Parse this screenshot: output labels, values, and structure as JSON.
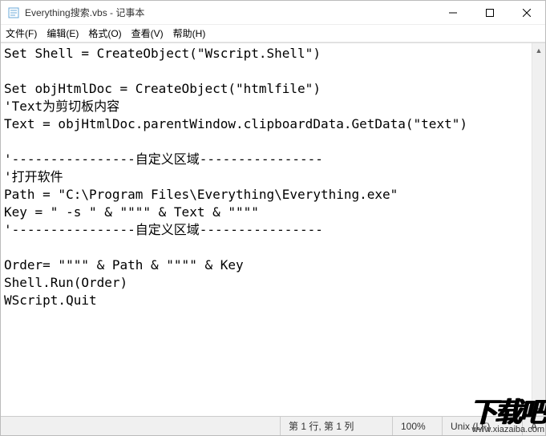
{
  "window": {
    "title": "Everything搜索.vbs - 记事本"
  },
  "menu": {
    "file": "文件(F)",
    "edit": "编辑(E)",
    "format": "格式(O)",
    "view": "查看(V)",
    "help": "帮助(H)"
  },
  "code": {
    "l1": "Set Shell = CreateObject(\"Wscript.Shell\")",
    "l2": "",
    "l3": "Set objHtmlDoc = CreateObject(\"htmlfile\")",
    "l4": "'Text为剪切板内容",
    "l5": "Text = objHtmlDoc.parentWindow.clipboardData.GetData(\"text\")",
    "l6": "",
    "l7": "'----------------自定义区域----------------",
    "l8": "'打开软件",
    "l9": "Path = \"C:\\Program Files\\Everything\\Everything.exe\"",
    "l10": "Key = \" -s \" & \"\"\"\" & Text & \"\"\"\"",
    "l11": "'----------------自定义区域----------------",
    "l12": "",
    "l13": "Order= \"\"\"\" & Path & \"\"\"\" & Key",
    "l14": "Shell.Run(Order)",
    "l15": "WScript.Quit"
  },
  "status": {
    "position": "第 1 行, 第 1 列",
    "zoom": "100%",
    "eol": "Unix (LF)",
    "enc_partial": "A"
  },
  "watermark": {
    "text": "下载吧",
    "url": "www.xiazaiba.com"
  }
}
